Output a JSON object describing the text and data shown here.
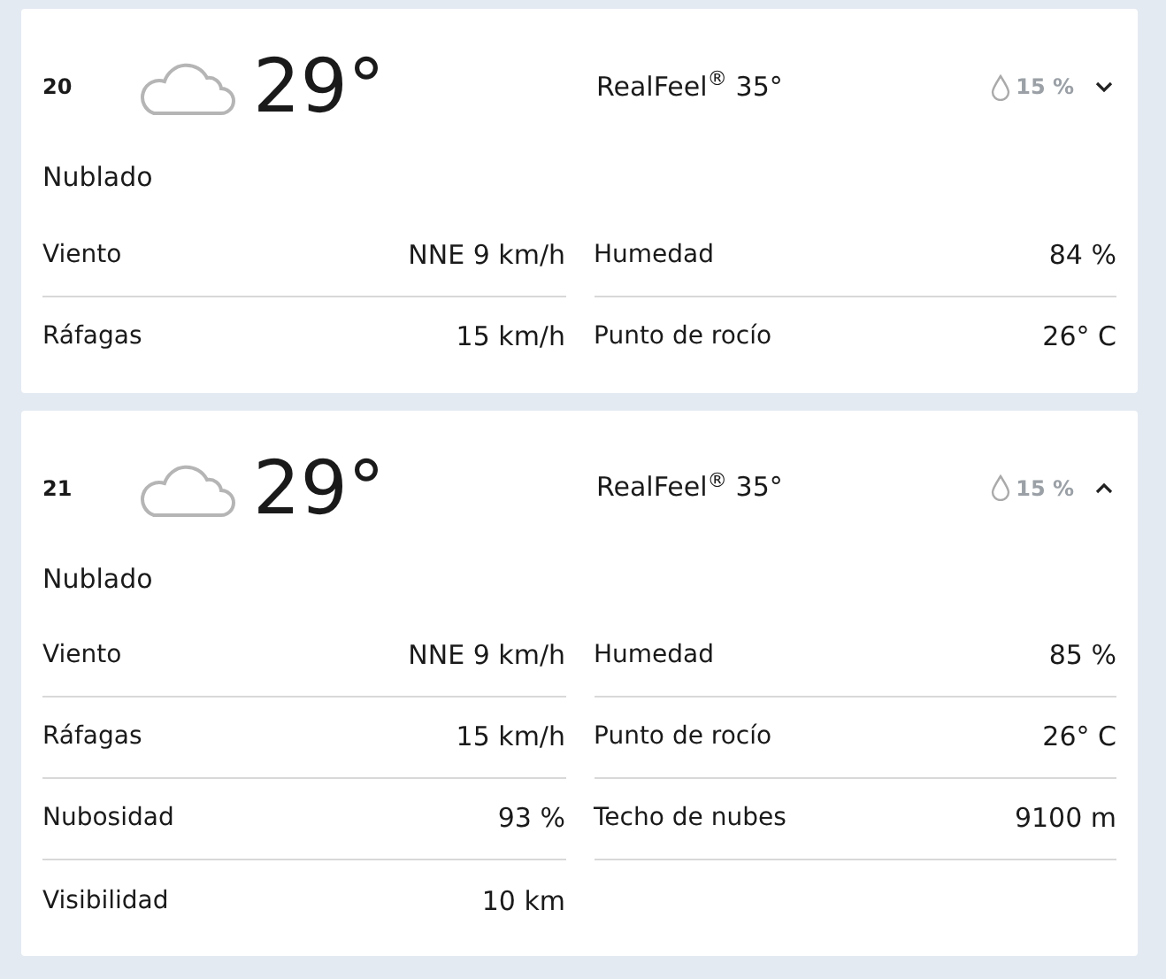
{
  "hours": [
    {
      "hour": "20",
      "temperature": "29°",
      "realfeel": "RealFeel$^{®}$ 35°",
      "precipitation": "15 %",
      "expanded": false,
      "condition": "Nublado",
      "details": [
        {
          "label": "Viento",
          "value": "NNE 9 km/h"
        },
        {
          "label": "Humedad",
          "value": "84 %"
        },
        {
          "label": "Ráfagas",
          "value": "15 km/h"
        },
        {
          "label": "Punto de rocío",
          "value": "26° C"
        }
      ]
    },
    {
      "hour": "21",
      "temperature": "29°",
      "realfeel": "RealFeel$^{®}$ 35°",
      "precipitation": "15 %",
      "expanded": true,
      "condition": "Nublado",
      "details": [
        {
          "label": "Viento",
          "value": "NNE 9 km/h"
        },
        {
          "label": "Humedad",
          "value": "85 %"
        },
        {
          "label": "Ráfagas",
          "value": "15 km/h"
        },
        {
          "label": "Punto de rocío",
          "value": "26° C"
        },
        {
          "label": "Nubosidad",
          "value": "93 %"
        },
        {
          "label": "Techo de nubes",
          "value": "9100 m"
        },
        {
          "label": "Visibilidad",
          "value": "10 km"
        }
      ]
    }
  ]
}
